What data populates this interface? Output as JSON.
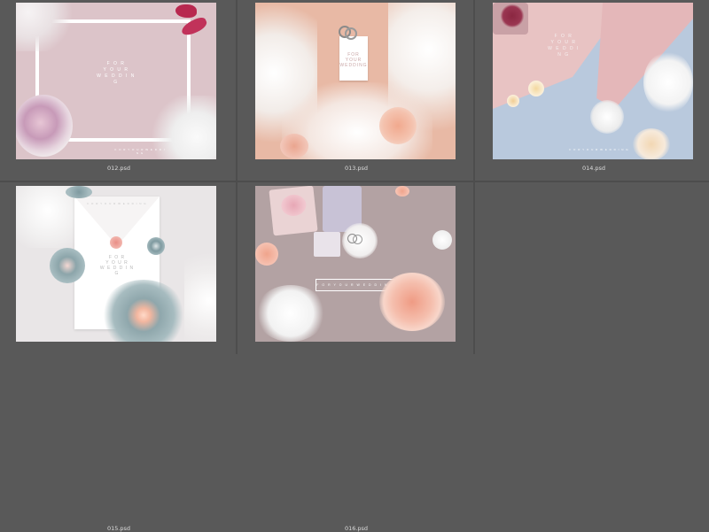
{
  "files": [
    {
      "name": "012.psd",
      "card": {
        "for_line": "F O R",
        "your_line": "Y O U R",
        "wedding_line": "W E D D I N G",
        "footer": "F O R   Y O U R   W E D D I N G"
      }
    },
    {
      "name": "013.psd",
      "card": {
        "for_line": "FOR",
        "your_line": "YOUR",
        "wedding_line": "WEDDING"
      }
    },
    {
      "name": "014.psd",
      "card": {
        "for_line": "F O R",
        "your_line": "Y O U R",
        "wedding_line": "W E D D I N G",
        "footer": "F O R   Y O U R   W E D D I N G"
      }
    },
    {
      "name": "015.psd",
      "card": {
        "top_line": "F O R   Y O U R   W E D D I N G",
        "for_line": "F O R",
        "your_line": "Y O U R",
        "wedding_line": "W E D D I N G"
      }
    },
    {
      "name": "016.psd",
      "card": {
        "banner": "F O R   Y O U R   W E D D I N G"
      }
    }
  ],
  "colors": {
    "background": "#595959",
    "filename_text": "#dcdcdc"
  }
}
